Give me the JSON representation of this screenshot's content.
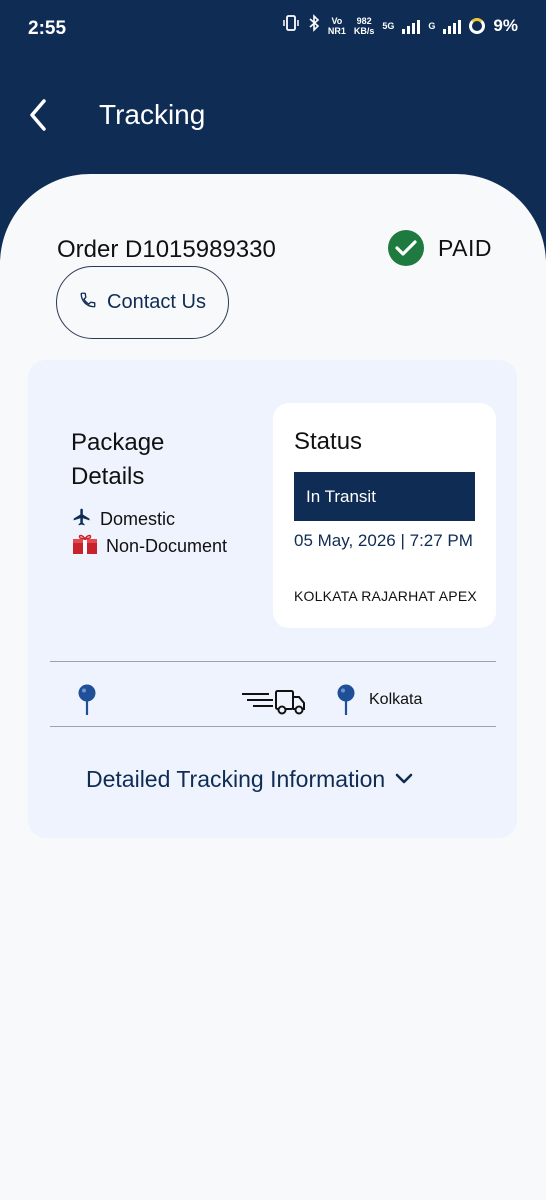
{
  "status_bar": {
    "time": "2:55",
    "volte_top": "Vo",
    "volte_bottom": "NR1",
    "speed_value": "982",
    "speed_unit": "KB/s",
    "network_5g": "5G",
    "network_g": "G",
    "battery": "9%"
  },
  "nav": {
    "title": "Tracking",
    "back_icon": "chevron-left-icon"
  },
  "order": {
    "title": "Order D1015989330",
    "payment_status": "PAID",
    "payment_icon": "check-circle-icon",
    "contact_label": "Contact Us",
    "contact_icon": "phone-icon"
  },
  "package": {
    "title": "Package Details",
    "type_label": "Domestic",
    "type_icon": "airplane-icon",
    "content_label": "Non-Document",
    "content_icon": "gift-box-icon"
  },
  "status": {
    "title": "Status",
    "state": "In Transit",
    "datetime": "05 May, 2026 | 7:27 PM",
    "location": "KOLKATA RAJARHAT APEX"
  },
  "route": {
    "origin": "",
    "destination": "Kolkata",
    "pin_icon": "location-pin-icon",
    "truck_icon": "delivery-truck-icon"
  },
  "detail_link": {
    "label": "Detailed Tracking Information",
    "icon": "chevron-down-icon"
  },
  "colors": {
    "primary": "#0f2c55",
    "paid_green": "#1e7a3f",
    "card_bg": "#eef3fd",
    "pin_blue": "#1f4f96",
    "gift_red": "#c8232c"
  }
}
